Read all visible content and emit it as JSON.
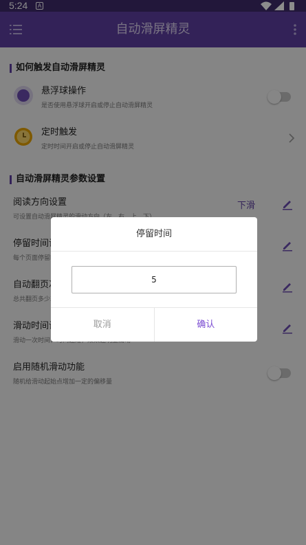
{
  "status_bar": {
    "time": "5:24",
    "notification_glyph": "A"
  },
  "app_bar": {
    "title": "自动滑屏精灵"
  },
  "sections": [
    {
      "title": "如何触发自动滑屏精灵",
      "items": [
        {
          "title": "悬浮球操作",
          "subtitle": "是否使用悬浮球开启或停止自动滑屏精灵",
          "icon": "floating-ball-icon",
          "toggle_on": false
        },
        {
          "title": "定时触发",
          "subtitle": "定时时间开启或停止自动滑屏精灵",
          "icon": "clock-icon"
        }
      ]
    },
    {
      "title": "自动滑屏精灵参数设置",
      "items": [
        {
          "title": "阅读方向设置",
          "subtitle": "可设置自动滑屏精灵的滑动方向（左、右、上、下）",
          "value": "下滑"
        },
        {
          "title": "停留时间设置",
          "subtitle": "每个页面停留时间"
        },
        {
          "title": "自动翻页次数",
          "subtitle": "总共翻页多少次"
        },
        {
          "title": "滑动时间设置",
          "subtitle": "滑动一次时间，时间越短，效果越明显滑动"
        },
        {
          "title": "启用随机滑动功能",
          "subtitle": "随机给滑动起始点增加一定的偏移量",
          "toggle_on": false
        }
      ]
    }
  ],
  "dialog": {
    "title": "停留时间",
    "input_value": "5",
    "cancel_label": "取消",
    "confirm_label": "确认"
  },
  "colors": {
    "primary": "#5e3ea0",
    "accent": "#7b4cd2",
    "status_bar": "#3e2a6b"
  }
}
